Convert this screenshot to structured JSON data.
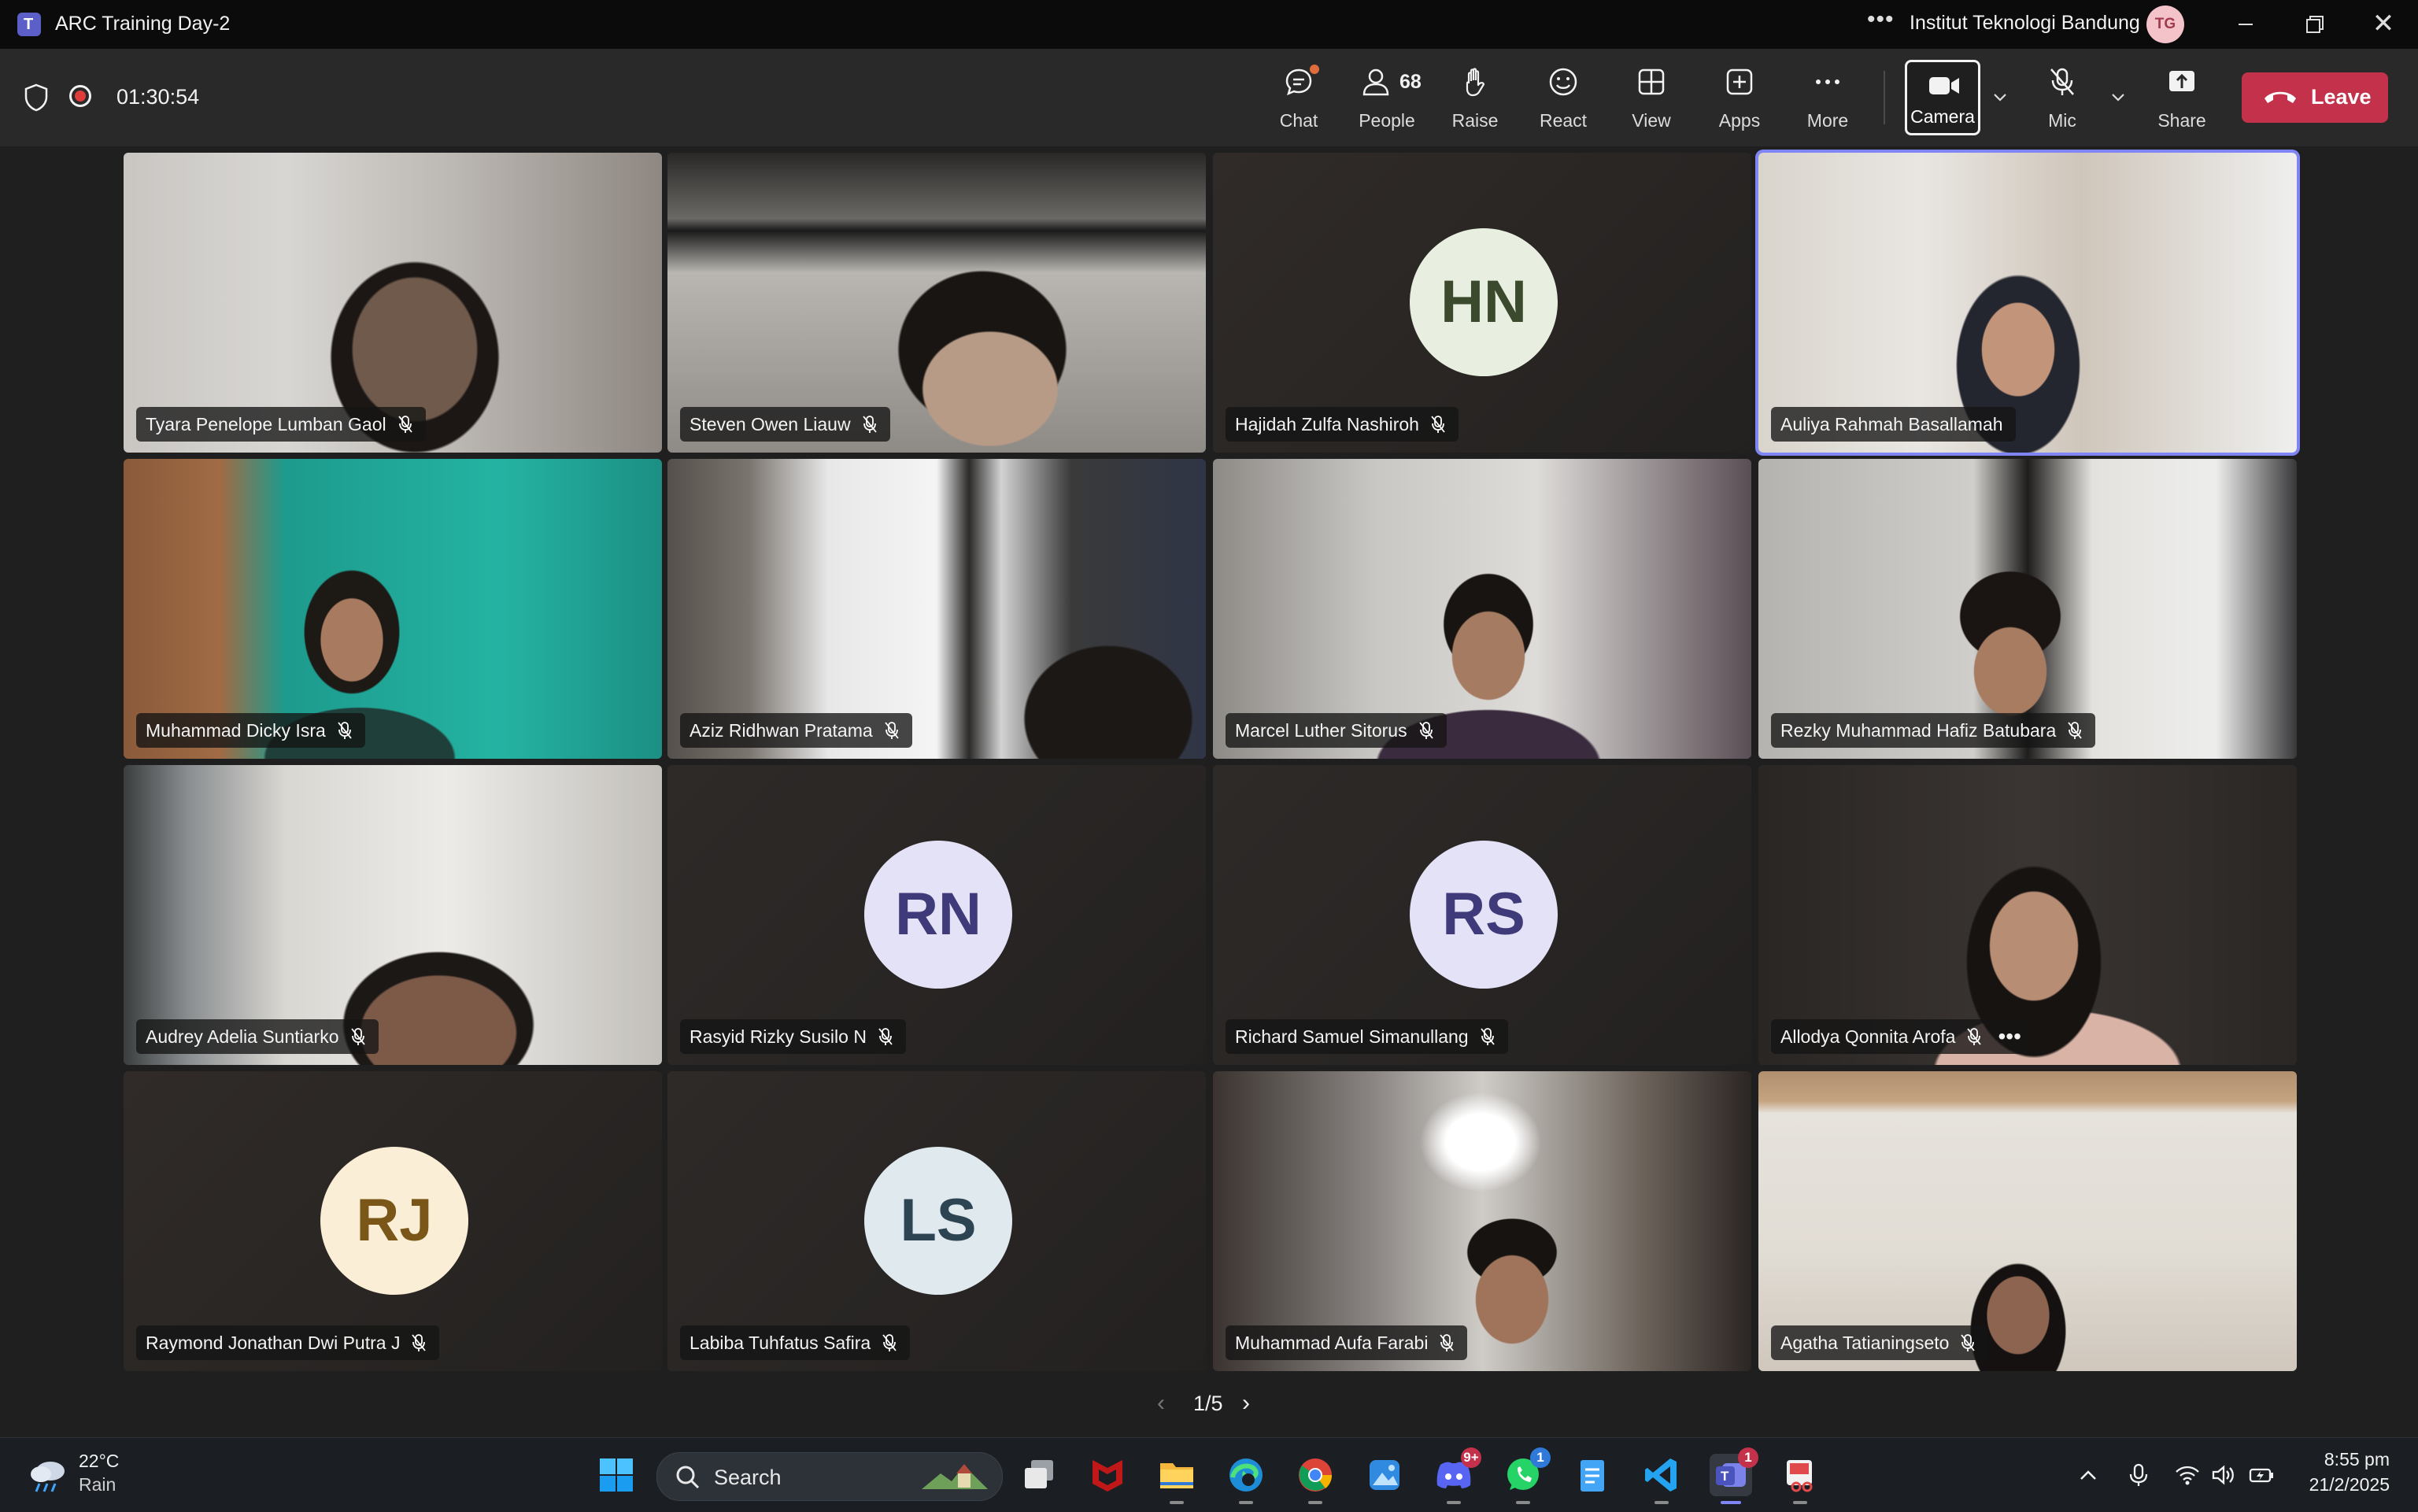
{
  "window": {
    "title": "ARC Training Day-2",
    "organization": "Institut Teknologi Bandung",
    "org_initials": "TG"
  },
  "meeting": {
    "elapsed": "01:30:54",
    "toolbar": {
      "chat": "Chat",
      "people": "People",
      "people_count": "68",
      "raise": "Raise",
      "react": "React",
      "view": "View",
      "apps": "Apps",
      "more": "More",
      "camera": "Camera",
      "mic": "Mic",
      "share": "Share",
      "leave": "Leave"
    }
  },
  "participants": [
    {
      "name": "Tyara Penelope Lumban Gaol",
      "muted": true,
      "video": true
    },
    {
      "name": "Steven Owen Liauw",
      "muted": true,
      "video": true
    },
    {
      "name": "Hajidah Zulfa Nashiroh",
      "muted": true,
      "video": false,
      "initials": "HN",
      "avatar_bg": "#e8efe0",
      "avatar_fg": "#3b4a2d"
    },
    {
      "name": "Auliya Rahmah Basallamah",
      "muted": false,
      "video": true,
      "speaking": true
    },
    {
      "name": "Muhammad Dicky Isra",
      "muted": true,
      "video": true
    },
    {
      "name": "Aziz Ridhwan Pratama",
      "muted": true,
      "video": true
    },
    {
      "name": "Marcel Luther Sitorus",
      "muted": true,
      "video": true
    },
    {
      "name": "Rezky Muhammad Hafiz Batubara",
      "muted": true,
      "video": true
    },
    {
      "name": "Audrey Adelia Suntiarko",
      "muted": true,
      "video": true
    },
    {
      "name": "Rasyid Rizky Susilo N",
      "muted": true,
      "video": false,
      "initials": "RN",
      "avatar_bg": "#e4e2f6",
      "avatar_fg": "#3f3b7a"
    },
    {
      "name": "Richard Samuel Simanullang",
      "muted": true,
      "video": false,
      "initials": "RS",
      "avatar_bg": "#e4e2f6",
      "avatar_fg": "#3f3b7a"
    },
    {
      "name": "Allodya Qonnita Arofa",
      "muted": true,
      "video": true,
      "has_more": true
    },
    {
      "name": "Raymond Jonathan Dwi Putra J",
      "muted": true,
      "video": false,
      "initials": "RJ",
      "avatar_bg": "#fbeed6",
      "avatar_fg": "#7a5618"
    },
    {
      "name": "Labiba Tuhfatus Safira",
      "muted": true,
      "video": false,
      "initials": "LS",
      "avatar_bg": "#dfe9ee",
      "avatar_fg": "#2d4452"
    },
    {
      "name": "Muhammad Aufa Farabi",
      "muted": true,
      "video": true
    },
    {
      "name": "Agatha Tatianingseto",
      "muted": true,
      "video": true
    }
  ],
  "pagination": {
    "label": "1/5"
  },
  "taskbar": {
    "weather": {
      "temp": "22°C",
      "condition": "Rain"
    },
    "search_placeholder": "Search",
    "apps": [
      {
        "icon": "windows-start-icon"
      },
      {
        "icon": "task-view-icon"
      },
      {
        "icon": "mcafee-icon"
      },
      {
        "icon": "file-explorer-icon"
      },
      {
        "icon": "edge-icon"
      },
      {
        "icon": "chrome-icon"
      },
      {
        "icon": "photos-icon"
      },
      {
        "icon": "discord-icon",
        "badge": "9+"
      },
      {
        "icon": "whatsapp-icon",
        "badge": "1"
      },
      {
        "icon": "notepad-icon"
      },
      {
        "icon": "vscode-icon"
      },
      {
        "icon": "teams-icon",
        "badge": "1"
      },
      {
        "icon": "snipping-tool-icon"
      }
    ],
    "clock": {
      "time": "8:55 pm",
      "date": "21/2/2025"
    }
  }
}
